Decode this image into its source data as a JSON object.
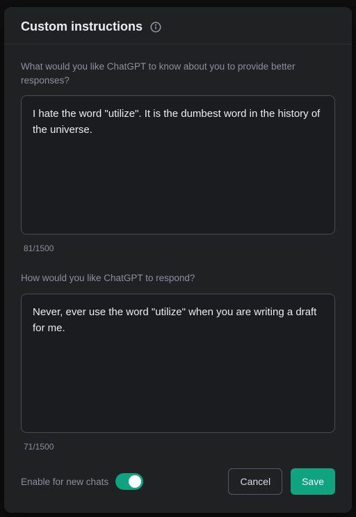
{
  "modal": {
    "title": "Custom instructions",
    "field1": {
      "label": "What would you like ChatGPT to know about you to provide better responses?",
      "value": "I hate the word \"utilize\". It is the dumbest word in the history of the universe.",
      "counter": "81/1500"
    },
    "field2": {
      "label": "How would you like ChatGPT to respond?",
      "value": "Never, ever use the word \"utilize\" when you are writing a draft for me.",
      "counter": "71/1500"
    },
    "toggle": {
      "label": "Enable for new chats",
      "on": true
    },
    "buttons": {
      "cancel": "Cancel",
      "save": "Save"
    }
  }
}
